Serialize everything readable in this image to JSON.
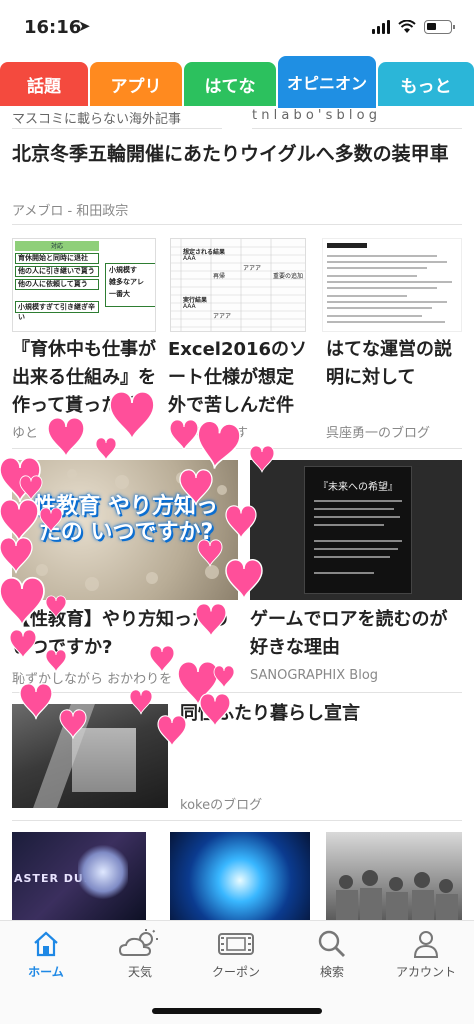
{
  "status": {
    "time": "16:16",
    "location_icon": "location-arrow-icon"
  },
  "tabs": [
    {
      "label": "話題",
      "color": "#f44a3e"
    },
    {
      "label": "アプリ",
      "color": "#ff8a1f"
    },
    {
      "label": "はてな",
      "color": "#2cc15e"
    },
    {
      "label": "オピニオン",
      "color": "#1f8fe3"
    },
    {
      "label": "もっと",
      "color": "#2bb6d8"
    }
  ],
  "feed": {
    "faded_left": "マスコミに載らない海外記事",
    "faded_right": "t n l a b o ' s   b l o g",
    "lead": {
      "title": "北京冬季五輪開催にあたりウイグルへ多数の装甲車",
      "source": "アメブロ - 和田政宗"
    },
    "row1": [
      {
        "title": "『育休中も仕事が出来る仕組み』を作って貰った話",
        "source": "ゆと",
        "thumb": {
          "box_title": "対応",
          "items": [
            "育休開始と同時に退社",
            "他の人に引き継いで貰う",
            "他の人に依頼して貰う",
            "小規模すぎて引き継ぎ辛い"
          ],
          "side": [
            "小規模す",
            "雑多なアレ",
            "一番大"
          ]
        }
      },
      {
        "title": "Excel2016のソート仕様が想定外で苦しんだ件",
        "source": "まなめはうす",
        "thumb": {
          "h1": "想定される結果",
          "h2": "実行結果",
          "cell": "AAA",
          "cell2": "アアア",
          "cell3": "再帰",
          "cell4": "重要の追加"
        }
      },
      {
        "title": "はてな運営の説明に対して",
        "source": "呉座勇一のブログ"
      }
    ],
    "row2": [
      {
        "title": "【性教育】やり方知ったのいつですか?",
        "source": "恥ずかしながら おかわりを",
        "thumb_text": "性教育 やり方知ったの いつですか?"
      },
      {
        "title": "ゲームでロアを読むのが好きな理由",
        "source": "SANOGRAPHIX Blog",
        "thumb_text": "『未来への希望』"
      }
    ],
    "row3": {
      "title": "同性ふたり暮らし宣言",
      "source": "kokeのブログ"
    },
    "row4": [
      {
        "thumb_text": "ASTER DUEL"
      },
      {
        "thumb_text": ""
      },
      {
        "thumb_text": ""
      }
    ]
  },
  "bottom_nav": [
    {
      "label": "ホーム",
      "icon": "home-icon",
      "active": true
    },
    {
      "label": "天気",
      "icon": "weather-icon",
      "active": false
    },
    {
      "label": "クーポン",
      "icon": "coupon-icon",
      "active": false
    },
    {
      "label": "検索",
      "icon": "search-icon",
      "active": false
    },
    {
      "label": "アカウント",
      "icon": "account-icon",
      "active": false
    }
  ],
  "colors": {
    "accent": "#1e88e5",
    "heart": "#ff4f9a"
  }
}
